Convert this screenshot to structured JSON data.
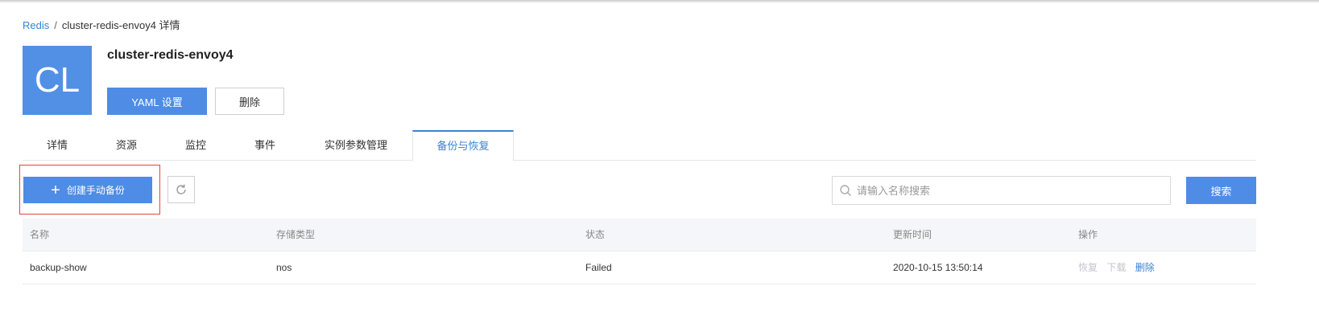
{
  "breadcrumb": {
    "root": "Redis",
    "separator": "/",
    "current": "cluster-redis-envoy4 详情"
  },
  "header": {
    "avatar_text": "CL",
    "title": "cluster-redis-envoy4",
    "yaml_button": "YAML 设置",
    "delete_button": "删除"
  },
  "tabs": [
    "详情",
    "资源",
    "监控",
    "事件",
    "实例参数管理",
    "备份与恢复"
  ],
  "active_tab": "备份与恢复",
  "toolbar": {
    "create_button": "创建手动备份",
    "create_icon": "+",
    "refresh_icon": "refresh-icon",
    "search_placeholder": "请输入名称搜索",
    "search_button": "搜索"
  },
  "table": {
    "columns": [
      "名称",
      "存储类型",
      "状态",
      "更新时间",
      "操作"
    ],
    "rows": [
      {
        "name": "backup-show",
        "storage": "nos",
        "status": "Failed",
        "updated": "2020-10-15 13:50:14",
        "actions": [
          "恢复",
          "下载",
          "删除"
        ]
      }
    ]
  },
  "colors": {
    "primary": "#4e8ce5",
    "link": "#3b82d6",
    "highlight": "#e0483d",
    "disabled": "#c0c4cc"
  }
}
